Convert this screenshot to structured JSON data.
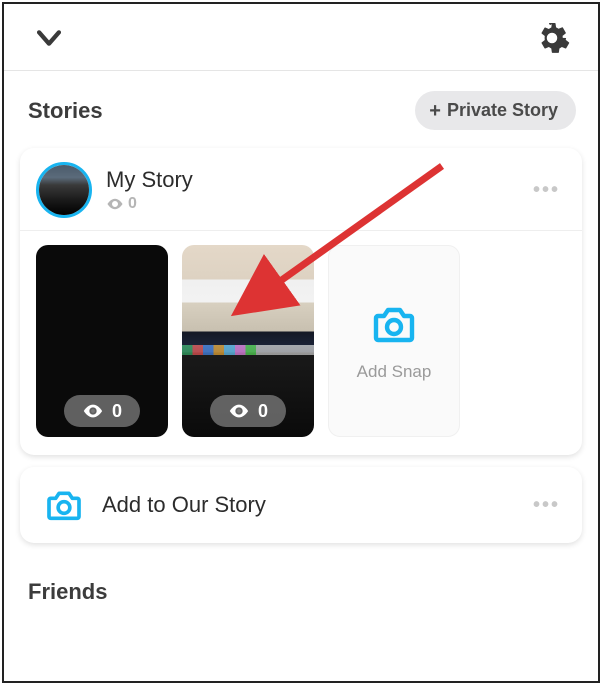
{
  "sections": {
    "stories_title": "Stories",
    "friends_title": "Friends"
  },
  "buttons": {
    "private_story": "Private Story",
    "add_snap": "Add Snap",
    "add_to_our_story": "Add to Our Story"
  },
  "my_story": {
    "title": "My Story",
    "views_count": "0"
  },
  "snaps": [
    {
      "views": "0"
    },
    {
      "views": "0"
    }
  ],
  "colors": {
    "accent": "#18b4f0"
  }
}
